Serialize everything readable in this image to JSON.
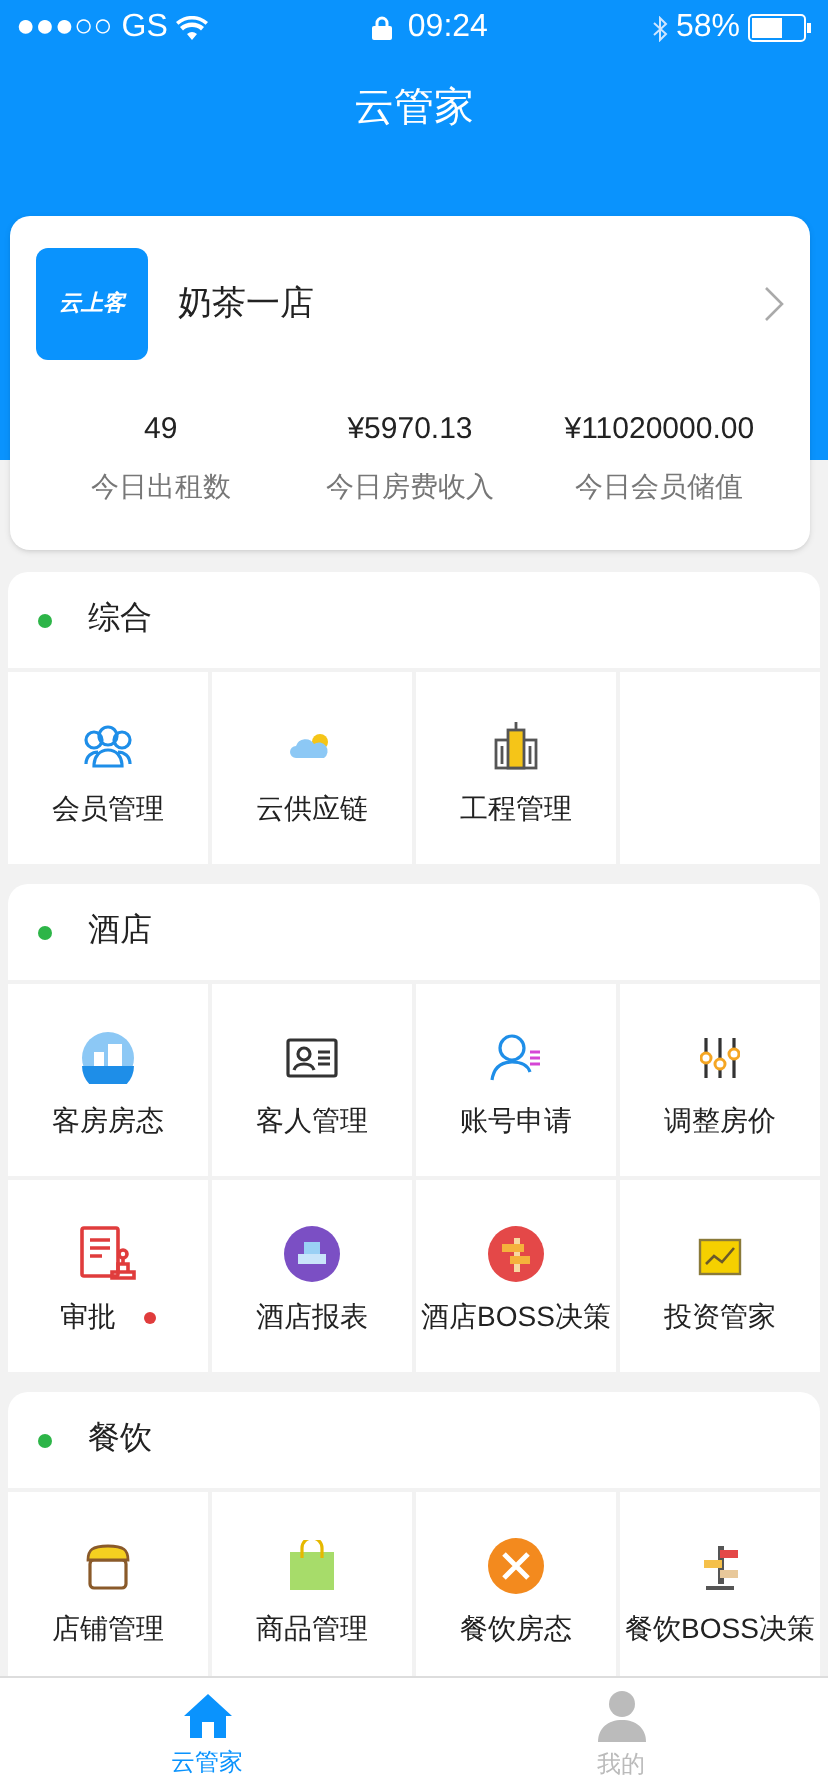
{
  "status_bar": {
    "carrier": "●●●○○ GS",
    "time": "09:24",
    "battery": "58%"
  },
  "header": {
    "title": "云管家"
  },
  "store": {
    "name": "奶茶一店",
    "logo_text": "云上客",
    "stats": [
      {
        "value": "49",
        "label": "今日出租数"
      },
      {
        "value": "¥5970.13",
        "label": "今日房费收入"
      },
      {
        "value": "¥11020000.00",
        "label": "今日会员储值"
      }
    ]
  },
  "sections": [
    {
      "title": "综合",
      "items": [
        {
          "label": "会员管理",
          "badge": false
        },
        {
          "label": "云供应链",
          "badge": false
        },
        {
          "label": "工程管理",
          "badge": false
        }
      ]
    },
    {
      "title": "酒店",
      "items": [
        {
          "label": "客房房态",
          "badge": false
        },
        {
          "label": "客人管理",
          "badge": false
        },
        {
          "label": "账号申请",
          "badge": false
        },
        {
          "label": "调整房价",
          "badge": false
        },
        {
          "label": "审批",
          "badge": true
        },
        {
          "label": "酒店报表",
          "badge": false
        },
        {
          "label": "酒店BOSS决策",
          "badge": false
        },
        {
          "label": "投资管家",
          "badge": false
        }
      ]
    },
    {
      "title": "餐饮",
      "items": [
        {
          "label": "店铺管理",
          "badge": false
        },
        {
          "label": "商品管理",
          "badge": false
        },
        {
          "label": "餐饮房态",
          "badge": false
        },
        {
          "label": "餐饮BOSS决策",
          "badge": false
        }
      ]
    }
  ],
  "tabs": [
    {
      "label": "云管家",
      "selected": true
    },
    {
      "label": "我的",
      "selected": false
    }
  ]
}
